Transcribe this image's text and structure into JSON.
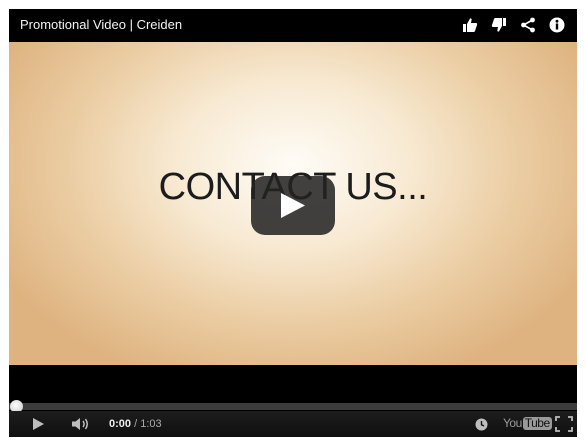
{
  "title_bar": {
    "title": "Promotional Video | Creiden",
    "icons": [
      "thumbs-up-icon",
      "thumbs-down-icon",
      "share-icon",
      "info-icon"
    ]
  },
  "video": {
    "frame_text": "CONTACT US...",
    "play_button_icon": "play-icon"
  },
  "controls": {
    "progress_fraction": 0.0,
    "time_current": "0:00",
    "time_separator": " / ",
    "time_total": "1:03",
    "youtube_logo": {
      "you": "You",
      "tube": "Tube"
    },
    "icons": [
      "play-icon",
      "volume-icon",
      "watch-later-icon",
      "fullscreen-icon"
    ]
  },
  "colors": {
    "background": "#000000",
    "title_text": "#f3f3f3",
    "video_center": "#fefcf7",
    "video_edge": "#deb380"
  }
}
